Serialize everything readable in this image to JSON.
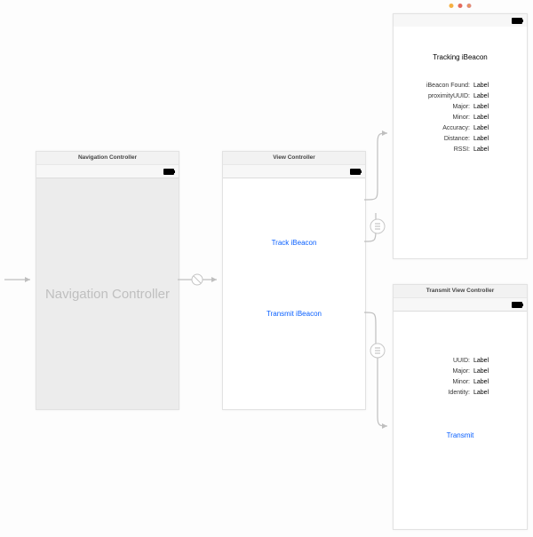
{
  "entry_arrow": true,
  "link_color": "#0a60ff",
  "scenes": {
    "navigation_controller": {
      "header": "Navigation Controller",
      "placeholder": "Navigation Controller"
    },
    "view_controller": {
      "header": "View Controller",
      "buttons": {
        "track": "Track iBeacon",
        "transmit": "Transmit iBeacon"
      }
    },
    "tracking": {
      "title": "Tracking iBeacon",
      "rows": [
        {
          "k": "iBeacon Found:",
          "v": "Label"
        },
        {
          "k": "proximityUUID:",
          "v": "Label"
        },
        {
          "k": "Major:",
          "v": "Label"
        },
        {
          "k": "Minor:",
          "v": "Label"
        },
        {
          "k": "Accuracy:",
          "v": "Label"
        },
        {
          "k": "Distance:",
          "v": "Label"
        },
        {
          "k": "RSSI:",
          "v": "Label"
        }
      ]
    },
    "transmit_vc": {
      "header": "Transmit View Controller",
      "rows": [
        {
          "k": "UUID:",
          "v": "Label"
        },
        {
          "k": "Major:",
          "v": "Label"
        },
        {
          "k": "Minor:",
          "v": "Label"
        },
        {
          "k": "Identity:",
          "v": "Label"
        }
      ],
      "action": "Transmit"
    }
  }
}
